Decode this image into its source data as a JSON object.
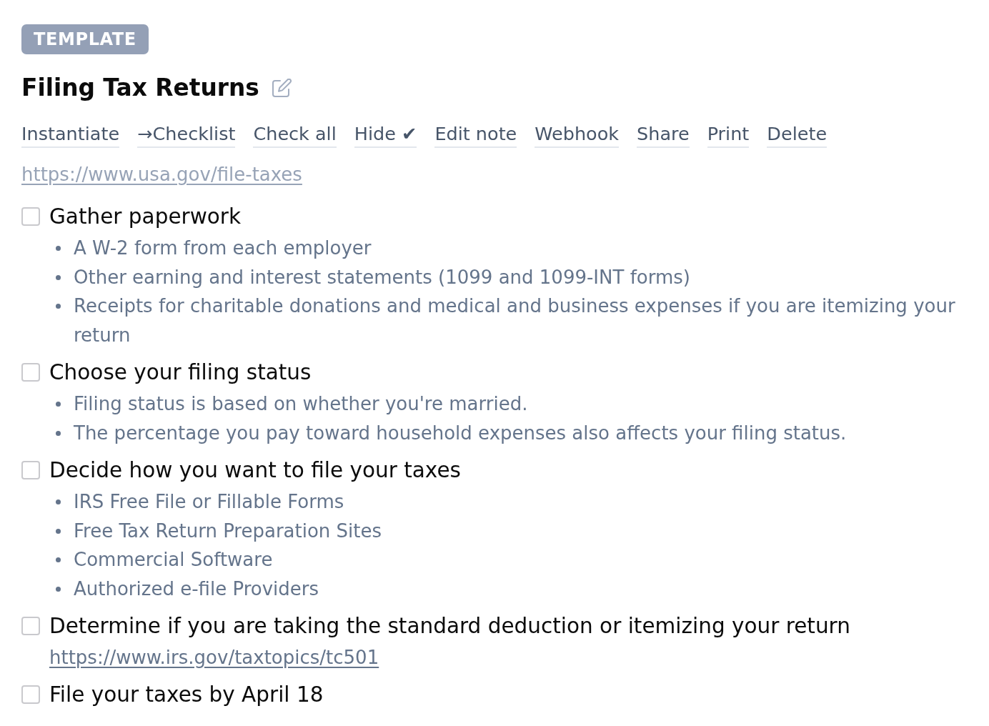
{
  "badge": "TEMPLATE",
  "title": "Filing Tax Returns",
  "actions": [
    "Instantiate",
    "→Checklist",
    "Check all",
    "Hide ✔",
    "Edit note",
    "Webhook",
    "Share",
    "Print",
    "Delete"
  ],
  "link": "https://www.usa.gov/file-taxes",
  "items": [
    {
      "label": "Gather paperwork",
      "checked": false,
      "bullets": [
        "A W-2 form from each employer",
        "Other earning and interest statements (1099 and 1099-INT forms)",
        "Receipts for charitable donations and medical and business expenses if you are itemizing your return"
      ]
    },
    {
      "label": "Choose your filing status",
      "checked": false,
      "bullets": [
        "Filing status is based on whether you're married.",
        "The percentage you pay toward household expenses also affects your filing status."
      ]
    },
    {
      "label": "Decide how you want to file your taxes",
      "checked": false,
      "bullets": [
        "IRS Free File or Fillable Forms",
        "Free Tax Return Preparation Sites",
        "Commercial Software",
        "Authorized e-file Providers"
      ]
    },
    {
      "label": "Determine if you are taking the standard deduction or itemizing your return",
      "checked": false,
      "link": "https://www.irs.gov/taxtopics/tc501"
    },
    {
      "label": "File your taxes by April 18",
      "checked": false
    }
  ]
}
